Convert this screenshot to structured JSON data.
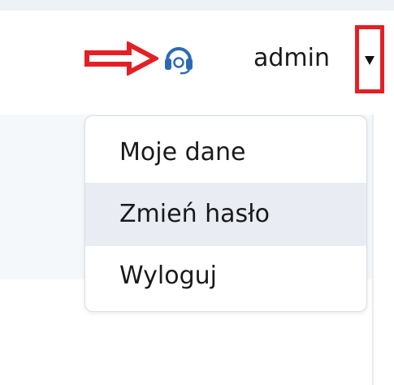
{
  "header": {
    "username": "admin",
    "support_icon": "headset-icon",
    "dropdown_icon": "caret-down-icon",
    "annotation_icon": "arrow-right-icon"
  },
  "user_menu": {
    "items": [
      {
        "label": "Moje dane"
      },
      {
        "label": "Zmień hasło",
        "hovered": true
      },
      {
        "label": "Wyloguj"
      }
    ]
  },
  "colors": {
    "annotation_red": "#e32025",
    "icon_blue": "#2c6bb3",
    "hover_bg": "#e9ecf3",
    "panel_bg": "#f5f8fb"
  }
}
